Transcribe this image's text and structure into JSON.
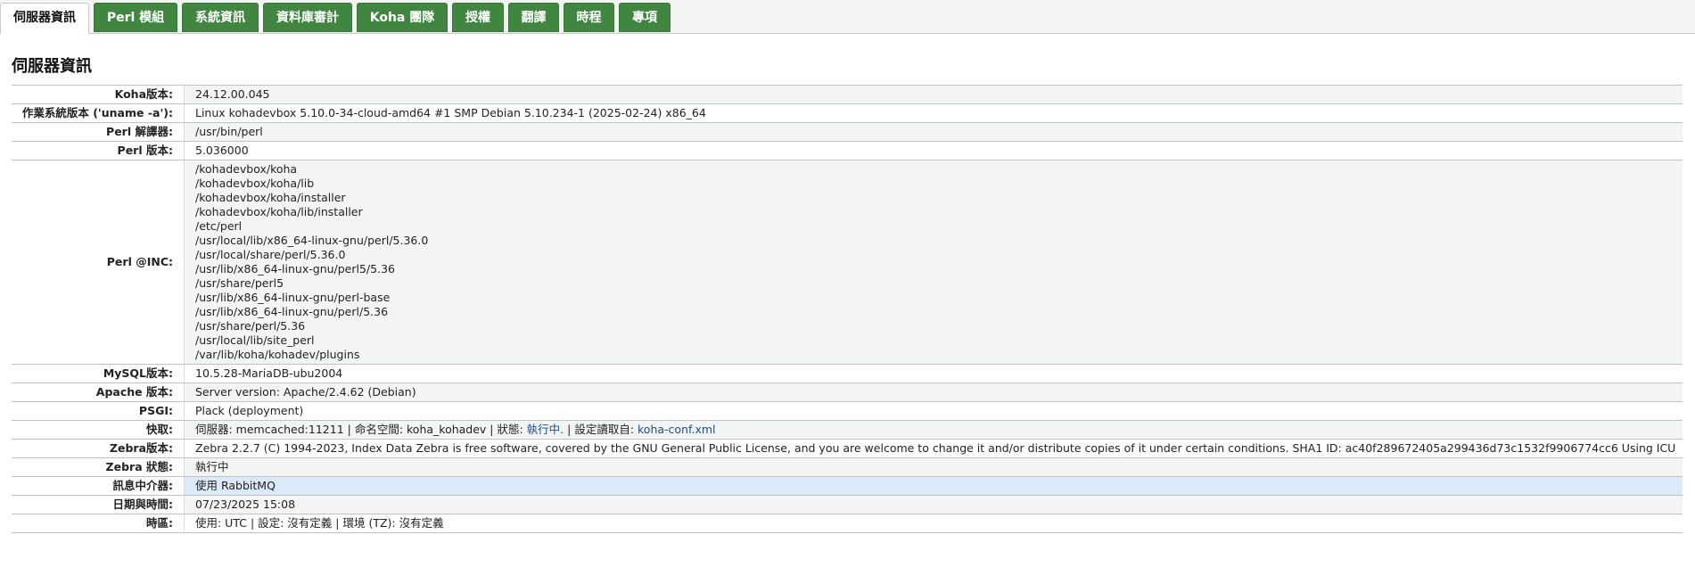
{
  "tabs": [
    {
      "label": "伺服器資訊",
      "active": true
    },
    {
      "label": "Perl 模組"
    },
    {
      "label": "系統資訊"
    },
    {
      "label": "資料庫審計"
    },
    {
      "label": "Koha 團隊"
    },
    {
      "label": "授權"
    },
    {
      "label": "翻譯"
    },
    {
      "label": "時程"
    },
    {
      "label": "專項"
    }
  ],
  "page_title": "伺服器資訊",
  "rows": {
    "koha_version": {
      "label": "Koha版本:",
      "value": "24.12.00.045"
    },
    "os_version": {
      "label": "作業系統版本 ('uname -a'):",
      "value": "Linux kohadevbox 5.10.0-34-cloud-amd64 #1 SMP Debian 5.10.234-1 (2025-02-24) x86_64"
    },
    "perl_interpreter": {
      "label": "Perl 解譯器:",
      "value": "/usr/bin/perl"
    },
    "perl_version": {
      "label": "Perl 版本:",
      "value": "5.036000"
    },
    "perl_inc": {
      "label": "Perl @INC:",
      "paths": [
        "/kohadevbox/koha",
        "/kohadevbox/koha/lib",
        "/kohadevbox/koha/installer",
        "/kohadevbox/koha/lib/installer",
        "/etc/perl",
        "/usr/local/lib/x86_64-linux-gnu/perl/5.36.0",
        "/usr/local/share/perl/5.36.0",
        "/usr/lib/x86_64-linux-gnu/perl5/5.36",
        "/usr/share/perl5",
        "/usr/lib/x86_64-linux-gnu/perl-base",
        "/usr/lib/x86_64-linux-gnu/perl/5.36",
        "/usr/share/perl/5.36",
        "/usr/local/lib/site_perl",
        "/var/lib/koha/kohadev/plugins"
      ]
    },
    "mysql_version": {
      "label": "MySQL版本:",
      "value": "10.5.28-MariaDB-ubu2004"
    },
    "apache_version": {
      "label": "Apache 版本:",
      "value": "Server version: Apache/2.4.62 (Debian)"
    },
    "psgi": {
      "label": "PSGI:",
      "value": "Plack (deployment)"
    },
    "cache": {
      "label": "快取:",
      "prefix": "伺服器: memcached:11211 | 命名空間: koha_kohadev | 狀態: ",
      "status": "執行中.",
      "middle": " | 設定讀取自: ",
      "config": "koha-conf.xml"
    },
    "zebra_version": {
      "label": "Zebra版本:",
      "value": "Zebra 2.2.7 (C) 1994-2023, Index Data Zebra is free software, covered by the GNU General Public License, and you are welcome to change it and/or distribute copies of it under certain conditions. SHA1 ID: ac40f289672405a299436d73c1532f9906774cc6 Using ICU"
    },
    "zebra_status": {
      "label": "Zebra 狀態:",
      "value": "執行中"
    },
    "message_broker": {
      "label": "訊息中介器:",
      "value": "使用 RabbitMQ"
    },
    "datetime": {
      "label": "日期與時間:",
      "value": "07/23/2025 15:08"
    },
    "timezone": {
      "label": "時區:",
      "value": "使用: UTC | 設定: 沒有定義 | 環境 (TZ): 沒有定義"
    }
  }
}
